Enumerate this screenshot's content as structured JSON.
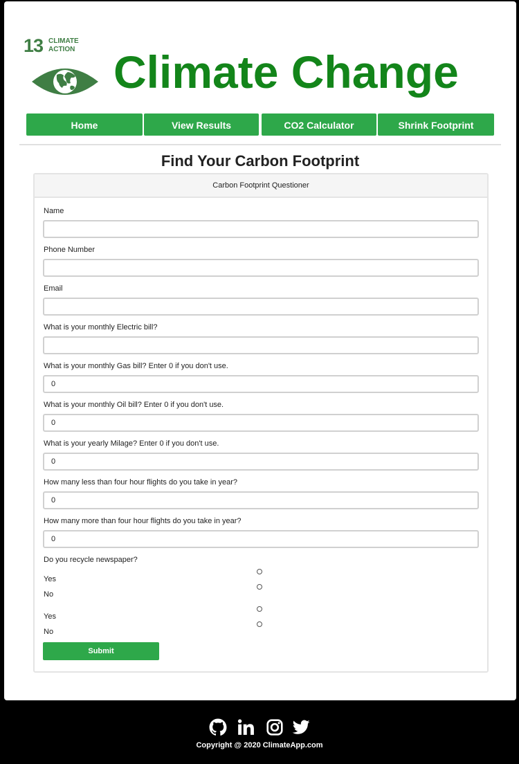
{
  "logo": {
    "number": "13",
    "caption_line1": "CLIMATE",
    "caption_line2": "ACTION",
    "icon": "eye-globe-icon",
    "color": "#3f7e44"
  },
  "header": {
    "title": "Climate Change",
    "title_color": "#13851a"
  },
  "nav": {
    "items": [
      {
        "label": "Home"
      },
      {
        "label": "View Results"
      },
      {
        "label": "CO2 Calculator"
      },
      {
        "label": "Shrink Footprint"
      }
    ],
    "color": "#2ea84a"
  },
  "form": {
    "title": "Find Your Carbon Footprint",
    "card_header": "Carbon Footprint Questioner",
    "fields": [
      {
        "label": "Name",
        "value": ""
      },
      {
        "label": "Phone Number",
        "value": ""
      },
      {
        "label": "Email",
        "value": ""
      },
      {
        "label": "What is your monthly Electric bill?",
        "value": ""
      },
      {
        "label": "What is your monthly Gas bill? Enter 0 if you don't use.",
        "value": "0"
      },
      {
        "label": "What is your monthly Oil bill? Enter 0 if you don't use.",
        "value": "0"
      },
      {
        "label": "What is your yearly Milage? Enter 0 if you don't use.",
        "value": "0"
      },
      {
        "label": "How many less than four hour flights do you take in year?",
        "value": "0"
      },
      {
        "label": "How many more than four hour flights do you take in year?",
        "value": "0"
      }
    ],
    "recycle_question": "Do you recycle newspaper?",
    "radio_groups": [
      {
        "yes": "Yes",
        "no": "No"
      },
      {
        "yes": "Yes",
        "no": "No"
      }
    ],
    "submit_label": "Submit"
  },
  "footer": {
    "icons": [
      "github-icon",
      "linkedin-icon",
      "instagram-icon",
      "twitter-icon"
    ],
    "copyright": "Copyright @ 2020 ClimateApp.com"
  }
}
